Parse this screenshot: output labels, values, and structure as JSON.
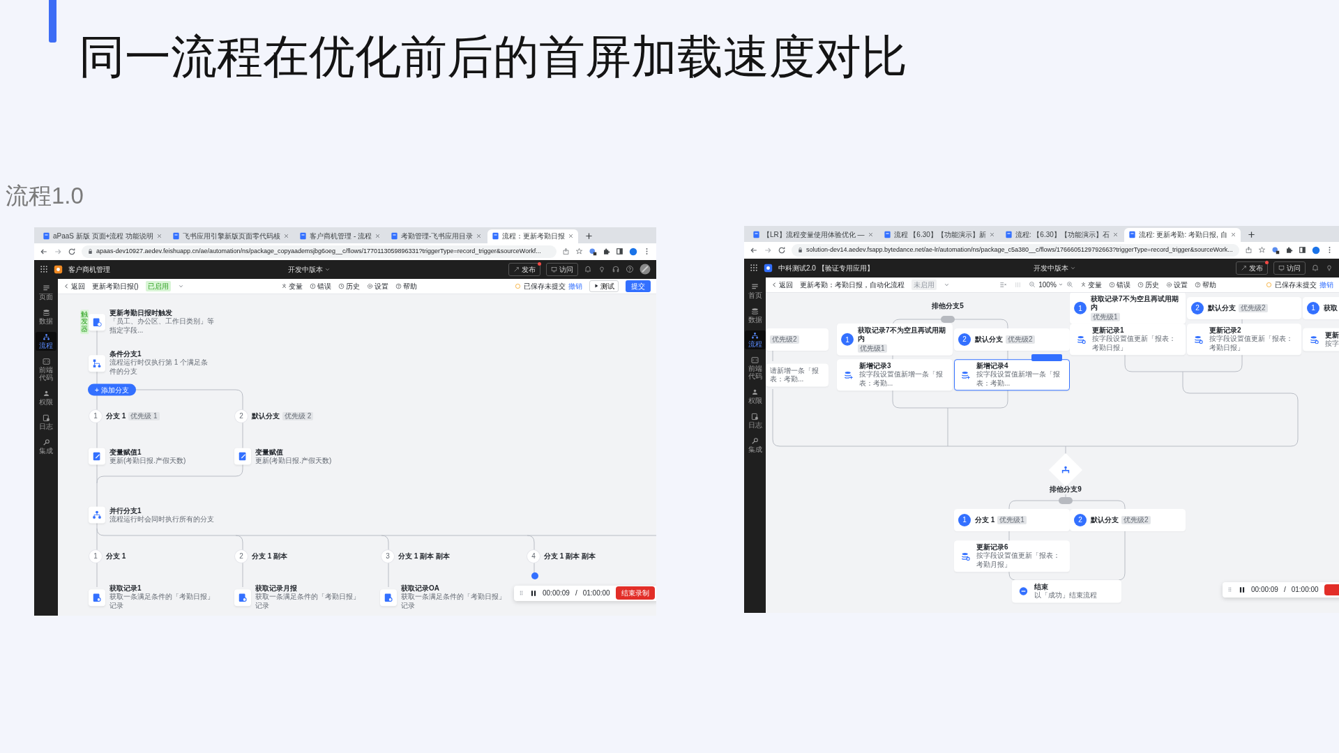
{
  "slide": {
    "title": "同一流程在优化前后的首屏加载速度对比",
    "section_label": "流程1.0"
  },
  "screenshots": [
    {
      "tabs": [
        {
          "title": "aPaaS 新版 页面+流程 功能说明",
          "selected": false
        },
        {
          "title": "飞书应用引擎新版页面零代码核",
          "selected": false
        },
        {
          "title": "客户商机管理 - 流程",
          "selected": false
        },
        {
          "title": "考勤管理-飞书应用目录",
          "selected": false
        },
        {
          "title": "流程：更新考勤日报",
          "selected": true
        }
      ],
      "url": "apaas-dev10927.aedev.feishuapp.cn/ae/automation/ns/package_copyaademsjbg6oeg__c/flows/1770113059896331?triggerType=record_trigger&sourceWorkf...",
      "app": {
        "name": "客户商机管理",
        "version": "开发中版本",
        "publish": "发布",
        "visit": "访问"
      },
      "sidebar": [
        {
          "label": "页面",
          "selected": false
        },
        {
          "label": "数据",
          "selected": false
        },
        {
          "label": "流程",
          "selected": true
        },
        {
          "label": "前端代码",
          "selected": false
        },
        {
          "label": "权限",
          "selected": false
        },
        {
          "label": "日志",
          "selected": false
        },
        {
          "label": "集成",
          "selected": false
        }
      ],
      "toolbar": {
        "back": "返回",
        "title": "更新考勤日报()",
        "status": "已启用",
        "enabled": true,
        "tools": [
          "变量",
          "错误",
          "历史",
          "设置",
          "帮助"
        ],
        "saved": "已保存未提交",
        "undo": "撤销",
        "test": "测试",
        "submit": "提交"
      },
      "nodes": [
        {
          "kind": "task",
          "tag": "触发器",
          "title": "更新考勤日报时触发",
          "desc": "「员工、办公区、工作日类别」等指定字段..."
        },
        {
          "kind": "task",
          "title": "条件分支1",
          "desc": "流程运行时仅执行第 1 个满足条件的分支"
        },
        {
          "kind": "button",
          "label": "+ 添加分支"
        },
        {
          "kind": "branch",
          "number": "1",
          "label": "分支 1",
          "tag": "优先级 1"
        },
        {
          "kind": "branch",
          "number": "2",
          "label": "默认分支",
          "tag": "优先级 2"
        },
        {
          "kind": "task",
          "title": "变量赋值1",
          "desc": "更新(考勤日报.产假天数)"
        },
        {
          "kind": "task",
          "title": "变量赋值",
          "desc": "更新(考勤日报.产假天数)"
        },
        {
          "kind": "task",
          "title": "并行分支1",
          "desc": "流程运行时会同时执行所有的分支"
        },
        {
          "kind": "branch",
          "number": "1",
          "label": "分支 1"
        },
        {
          "kind": "branch",
          "number": "2",
          "label": "分支 1 副本"
        },
        {
          "kind": "branch",
          "number": "3",
          "label": "分支 1 副本 副本"
        },
        {
          "kind": "branch",
          "number": "4",
          "label": "分支 1 副本 副本"
        },
        {
          "kind": "task",
          "title": "获取记录1",
          "desc": "获取一条满足条件的「考勤日报」记录"
        },
        {
          "kind": "task",
          "title": "获取记录月报",
          "desc": "获取一条满足条件的「考勤日报」记录"
        },
        {
          "kind": "task",
          "title": "获取记录OA",
          "desc": "获取一条满足条件的「考勤日报」记录"
        }
      ],
      "recorder": {
        "elapsed": "00:00:09",
        "separator": "/",
        "total": "01:00:00",
        "stop": "结束录制"
      }
    },
    {
      "tabs": [
        {
          "title": "【LR】流程变量使用体验优化 —",
          "selected": false
        },
        {
          "title": "流程 【6.30】【功能演示】新",
          "selected": false
        },
        {
          "title": "流程: 【6.30】【功能演示】石",
          "selected": false
        },
        {
          "title": "流程: 更新考勤: 考勤日报, 自",
          "selected": true
        }
      ],
      "url": "solution-dev14.aedev.fsapp.bytedance.net/ae-lr/automation/ns/package_c5a380__c/flows/1766605129792663?triggerType=record_trigger&sourceWork...",
      "app": {
        "name": "中科测试2.0 【验证专用应用】",
        "version": "开发中版本",
        "publish": "发布",
        "visit": "访问"
      },
      "sidebar": [
        {
          "label": "首页",
          "selected": false
        },
        {
          "label": "数据",
          "selected": false
        },
        {
          "label": "流程",
          "selected": true
        },
        {
          "label": "前端代码",
          "selected": false
        },
        {
          "label": "权限",
          "selected": false
        },
        {
          "label": "日志",
          "selected": false
        },
        {
          "label": "集成",
          "selected": false
        }
      ],
      "toolbar": {
        "back": "返回",
        "title": "更新考勤：考勤日报，自动化流程",
        "status": "未启用",
        "enabled": false,
        "zoom": "100%",
        "tools": [
          "变量",
          "错误",
          "历史",
          "设置",
          "帮助"
        ],
        "saved": "已保存未提交",
        "undo": "撤销"
      },
      "nodes": [
        {
          "kind": "label",
          "text": "排他分支5"
        },
        {
          "kind": "branch",
          "number": "1",
          "label": "获取记录7不为空且再试用期内",
          "tag": "优先级1",
          "selected": false
        },
        {
          "kind": "branch",
          "number": "2",
          "label": "默认分支",
          "tag": "优先级2",
          "selected": false
        },
        {
          "kind": "branch",
          "number": "1",
          "label": "获取",
          "selected": false
        },
        {
          "kind": "branch",
          "tag": "优先级2",
          "selected": false
        },
        {
          "kind": "branch",
          "number": "1",
          "label": "获取记录7不为空且再试用期内",
          "tag": "优先级1",
          "selected": false
        },
        {
          "kind": "branch",
          "number": "2",
          "label": "默认分支",
          "tag": "优先级2",
          "selected": false
        },
        {
          "kind": "task",
          "title": "更新记录1",
          "desc": "按字段设置值更新「报表：考勤日报」",
          "selected": false
        },
        {
          "kind": "task",
          "title": "更新记录2",
          "desc": "按字段设置值更新「报表：考勤日报」",
          "selected": false
        },
        {
          "kind": "task",
          "title": "更新",
          "desc": "按字",
          "selected": false
        },
        {
          "kind": "task",
          "desc": "请新增一条「报表：考勤...",
          "selected": false
        },
        {
          "kind": "task",
          "title": "新增记录3",
          "desc": "按字段设置值新增一条「报表：考勤...",
          "selected": false
        },
        {
          "kind": "task",
          "title": "新增记录4",
          "desc": "按字段设置值新增一条「报表：考勤...",
          "selected": true
        },
        {
          "kind": "gateway"
        },
        {
          "kind": "label",
          "text": "排他分支9"
        },
        {
          "kind": "branch",
          "number": "1",
          "label": "分支 1",
          "tag": "优先级1",
          "selected": false
        },
        {
          "kind": "branch",
          "number": "2",
          "label": "默认分支",
          "tag": "优先级2",
          "selected": false
        },
        {
          "kind": "task",
          "title": "更新记录6",
          "desc": "按字段设置值更新「报表：考勤月报」",
          "selected": false
        },
        {
          "kind": "task",
          "title": "结束",
          "desc": "以「成功」结束流程",
          "selected": false
        }
      ],
      "recorder": {
        "elapsed": "00:00:09",
        "separator": "/",
        "total": "01:00:00"
      }
    }
  ]
}
